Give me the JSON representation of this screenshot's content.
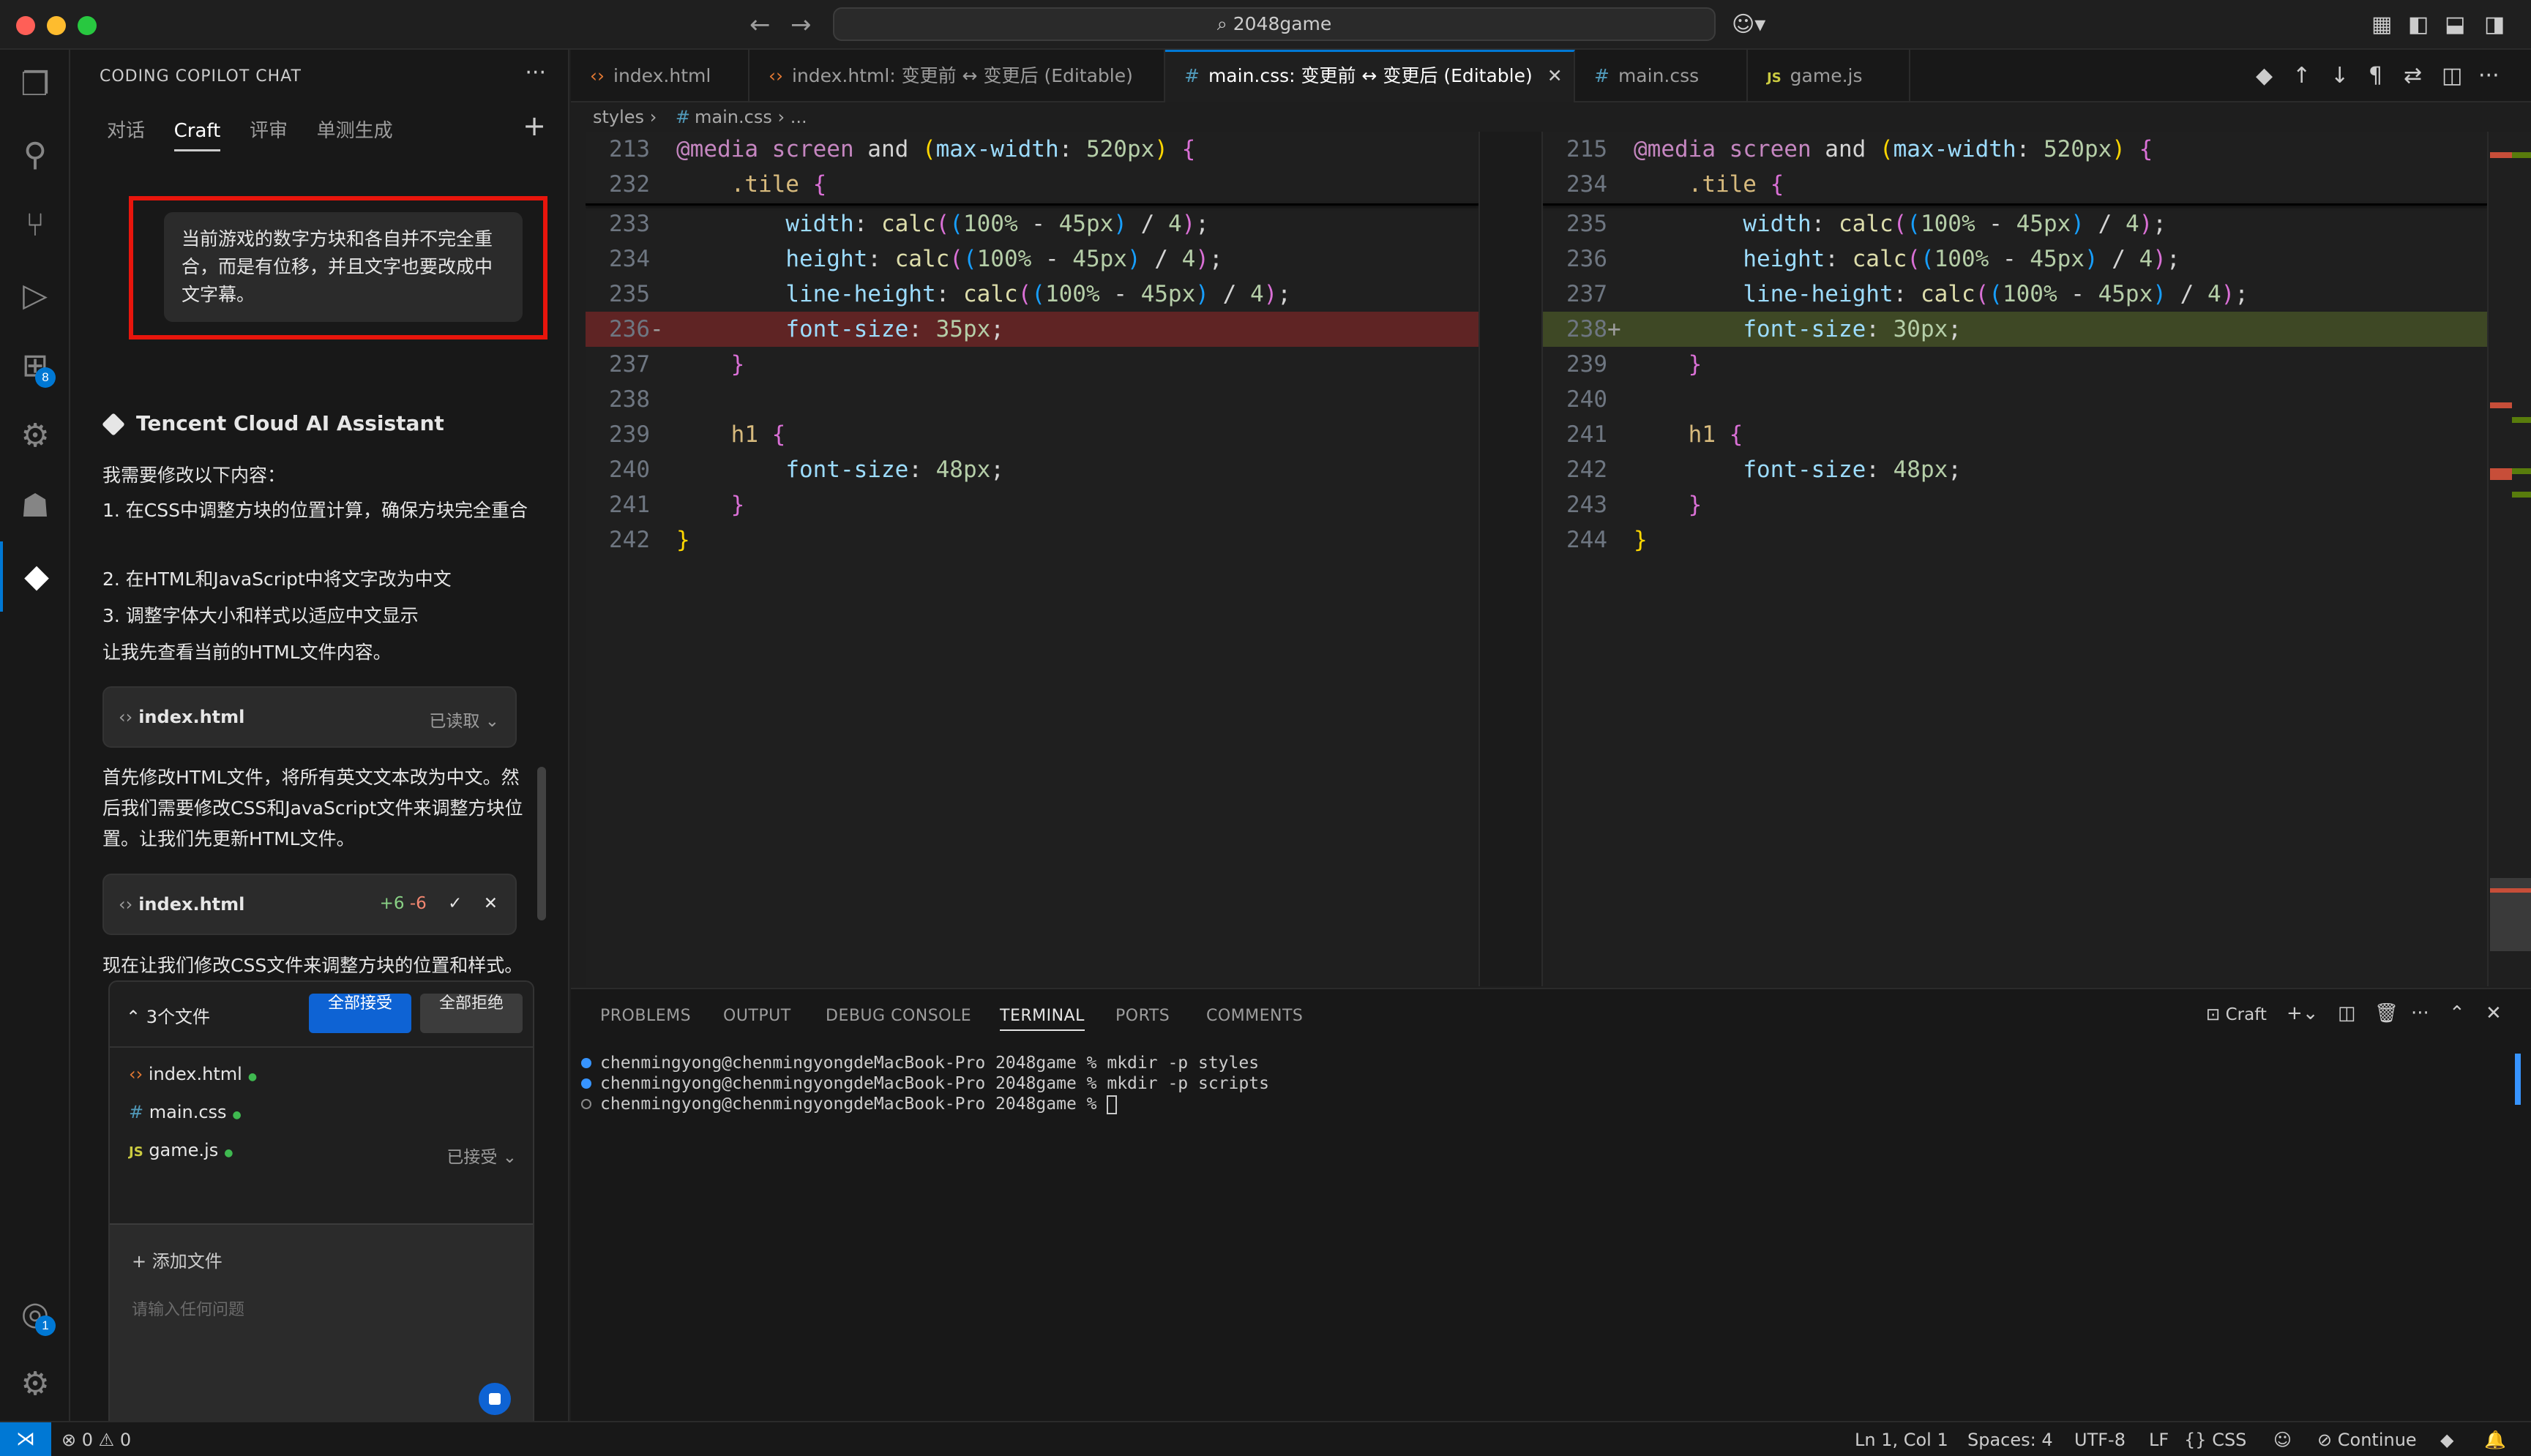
{
  "titlebar": {
    "search": "2048game"
  },
  "activitybar": {
    "extensions_badge": "8",
    "account_badge": "1"
  },
  "sidepanel": {
    "title": "CODING COPILOT CHAT",
    "tabs": [
      "对话",
      "Craft",
      "评审",
      "单测生成"
    ],
    "active_tab": "Craft",
    "user_message": "当前游戏的数字方块和各自并不完全重合，而是有位移，并且文字也要改成中文字幕。",
    "assistant_name": "Tencent Cloud AI Assistant",
    "intro": "我需要修改以下内容：",
    "steps": [
      "1. 在CSS中调整方块的位置计算，确保方块完全重合",
      "2. 在HTML和JavaScript中将文字改为中文",
      "3. 调整字体大小和样式以适应中文显示"
    ],
    "check_html": "让我先查看当前的HTML文件内容。",
    "card1": {
      "file": "index.html",
      "status": "已读取"
    },
    "paragraph2": "首先修改HTML文件，将所有英文文本改为中文。然后我们需要修改CSS和JavaScript文件来调整方块位置。让我们先更新HTML文件。",
    "card2": {
      "file": "index.html",
      "added": "+6",
      "removed": "-6"
    },
    "paragraph3": "现在让我们修改CSS文件来调整方块的位置和样式。主要需要：",
    "changes": {
      "count_label": "3个文件",
      "accept_all": "全部接受",
      "reject_all": "全部拒绝",
      "files": [
        "index.html",
        "main.css",
        "game.js"
      ],
      "accepted_label": "已接受"
    },
    "input": {
      "add_file": "+ 添加文件",
      "placeholder": "请输入任何问题"
    }
  },
  "tabs": [
    {
      "label": "index.html",
      "icon": "html"
    },
    {
      "label": "index.html: 变更前 ↔ 变更后 (Editable)",
      "icon": "html"
    },
    {
      "label": "main.css: 变更前 ↔ 变更后 (Editable)",
      "icon": "css",
      "active": true
    },
    {
      "label": "main.css",
      "icon": "css"
    },
    {
      "label": "game.js",
      "icon": "js"
    }
  ],
  "breadcrumb": [
    "styles",
    "main.css",
    "..."
  ],
  "diff_left": {
    "sticky": [
      {
        "ln": "213",
        "text": "@media screen and (max-width: 520px) {"
      },
      {
        "ln": "232",
        "text": "    .tile {"
      }
    ],
    "lines": [
      {
        "ln": "233",
        "text": "        width: calc((100% - 45px) / 4);"
      },
      {
        "ln": "234",
        "text": "        height: calc((100% - 45px) / 4);"
      },
      {
        "ln": "235",
        "text": "        line-height: calc((100% - 45px) / 4);"
      },
      {
        "ln": "236",
        "mark": "-",
        "text": "        font-size: 35px;",
        "type": "del"
      },
      {
        "ln": "237",
        "text": "    }"
      },
      {
        "ln": "238",
        "text": ""
      },
      {
        "ln": "239",
        "text": "    h1 {"
      },
      {
        "ln": "240",
        "text": "        font-size: 48px;"
      },
      {
        "ln": "241",
        "text": "    }"
      },
      {
        "ln": "242",
        "text": "}"
      }
    ]
  },
  "diff_right": {
    "sticky": [
      {
        "ln": "215",
        "text": "@media screen and (max-width: 520px) {"
      },
      {
        "ln": "234",
        "text": "    .tile {"
      }
    ],
    "lines": [
      {
        "ln": "235",
        "text": "        width: calc((100% - 45px) / 4);"
      },
      {
        "ln": "236",
        "text": "        height: calc((100% - 45px) / 4);"
      },
      {
        "ln": "237",
        "text": "        line-height: calc((100% - 45px) / 4);"
      },
      {
        "ln": "238",
        "mark": "+",
        "text": "        font-size: 30px;",
        "type": "add"
      },
      {
        "ln": "239",
        "text": "    }"
      },
      {
        "ln": "240",
        "text": ""
      },
      {
        "ln": "241",
        "text": "    h1 {"
      },
      {
        "ln": "242",
        "text": "        font-size: 48px;"
      },
      {
        "ln": "243",
        "text": "    }"
      },
      {
        "ln": "244",
        "text": "}"
      }
    ]
  },
  "panel": {
    "tabs": [
      "PROBLEMS",
      "OUTPUT",
      "DEBUG CONSOLE",
      "TERMINAL",
      "PORTS",
      "COMMENTS"
    ],
    "active_tab": "TERMINAL",
    "terminal_name": "Craft",
    "terminal_lines": [
      "chenmingyong@chenmingyongdeMacBook-Pro 2048game % mkdir -p styles",
      "chenmingyong@chenmingyongdeMacBook-Pro 2048game % mkdir -p scripts",
      "chenmingyong@chenmingyongdeMacBook-Pro 2048game % "
    ]
  },
  "statusbar": {
    "errors": "0",
    "warnings": "0",
    "position": "Ln 1, Col 1",
    "spaces": "Spaces: 4",
    "encoding": "UTF-8",
    "eol": "LF",
    "language": "CSS",
    "continue": "Continue"
  },
  "colors": {
    "accent": "#0078d4",
    "deleted_line": "#5a2424",
    "added_line": "#3f4a26",
    "highlight_box": "#e8150c"
  }
}
